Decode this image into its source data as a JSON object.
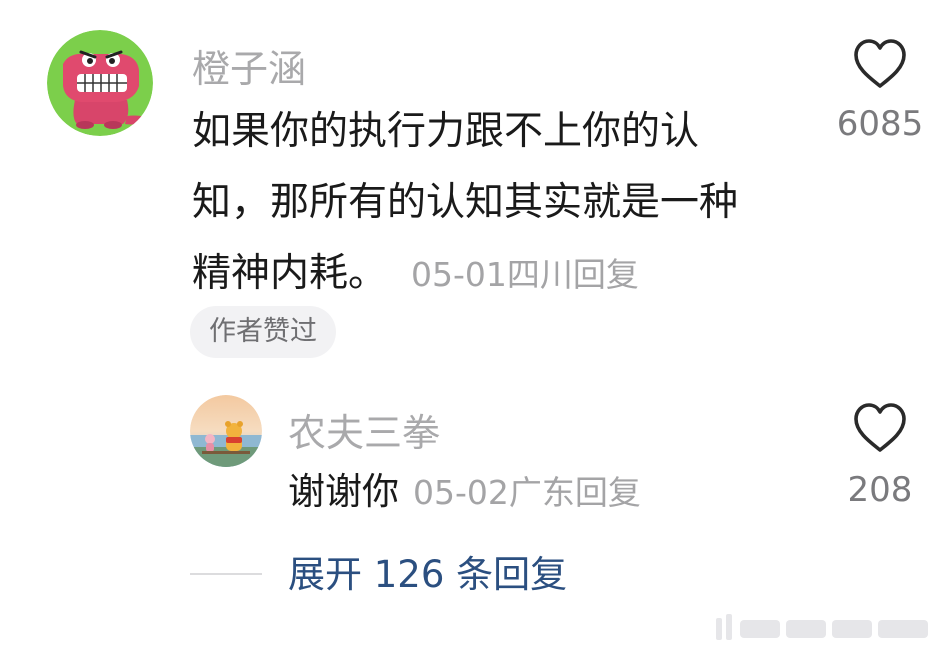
{
  "comment": {
    "username": "橙子涵",
    "text_lines": [
      "如果你的执行力跟不上你的认",
      "知，那所有的认知其实就是一种",
      "精神内耗。"
    ],
    "date": "05-01",
    "location": "四川",
    "reply_label": "回复",
    "like_count": "6085",
    "author_liked_badge": "作者赞过",
    "avatar_icon": "red-crocodile-avatar",
    "like_icon": "heart-outline-icon"
  },
  "reply": {
    "username": "农夫三拳",
    "text": "谢谢你",
    "date": "05-02",
    "location": "广东",
    "reply_label": "回复",
    "like_count": "208",
    "avatar_icon": "pooh-bear-avatar",
    "like_icon": "heart-outline-icon"
  },
  "expand": {
    "label": "展开 126 条回复"
  },
  "colors": {
    "username": "#a9a9ab",
    "text": "#1a1a1a",
    "meta": "#a4a4a6",
    "link": "#2b4f80",
    "badge_bg": "#f2f2f4",
    "avatar_green": "#7ccf4b",
    "crocodile_red": "#e04a6e"
  }
}
